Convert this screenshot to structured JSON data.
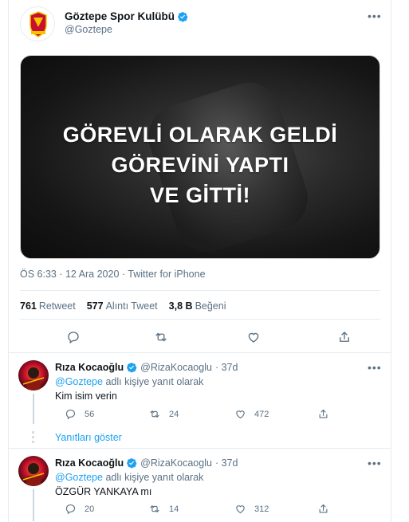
{
  "tweet": {
    "display_name": "Göztepe Spor Kulübü",
    "handle": "@Goztepe",
    "media_text": [
      "GÖREVLİ OLARAK GELDİ",
      "GÖREVİNİ YAPTI",
      "VE GİTTİ!"
    ],
    "logo_text": "GÖZTEPE",
    "timestamp": "ÖS 6:33 · 12 Ara 2020 · Twitter for iPhone",
    "stats": [
      {
        "count": "761",
        "label": "Retweet"
      },
      {
        "count": "577",
        "label": "Alıntı Tweet"
      },
      {
        "count": "3,8 B",
        "label": "Beğeni"
      }
    ]
  },
  "colors": {
    "accent": "#1da1f2",
    "muted": "#5b7083",
    "border": "#e6ecf0",
    "brand_red": "#c8102e",
    "brand_yellow": "#f5c400"
  },
  "replies": [
    {
      "display_name": "Rıza Kocaoğlu",
      "handle": "@RizaKocaoglu",
      "age": "· 37d",
      "reply_to_mention": "@Goztepe",
      "reply_to_suffix": "adlı kişiye yanıt olarak",
      "text": "Kim isim verin",
      "reply_count": "56",
      "retweet_count": "24",
      "like_count": "472"
    },
    {
      "display_name": "Rıza Kocaoğlu",
      "handle": "@RizaKocaoglu",
      "age": "· 37d",
      "reply_to_mention": "@Goztepe",
      "reply_to_suffix": "adlı kişiye yanıt olarak",
      "text": "ÖZGÜR YANKAYA mı",
      "reply_count": "20",
      "retweet_count": "14",
      "like_count": "312"
    }
  ],
  "show_replies_label": "Yanıtları göster",
  "more_label": "•••"
}
